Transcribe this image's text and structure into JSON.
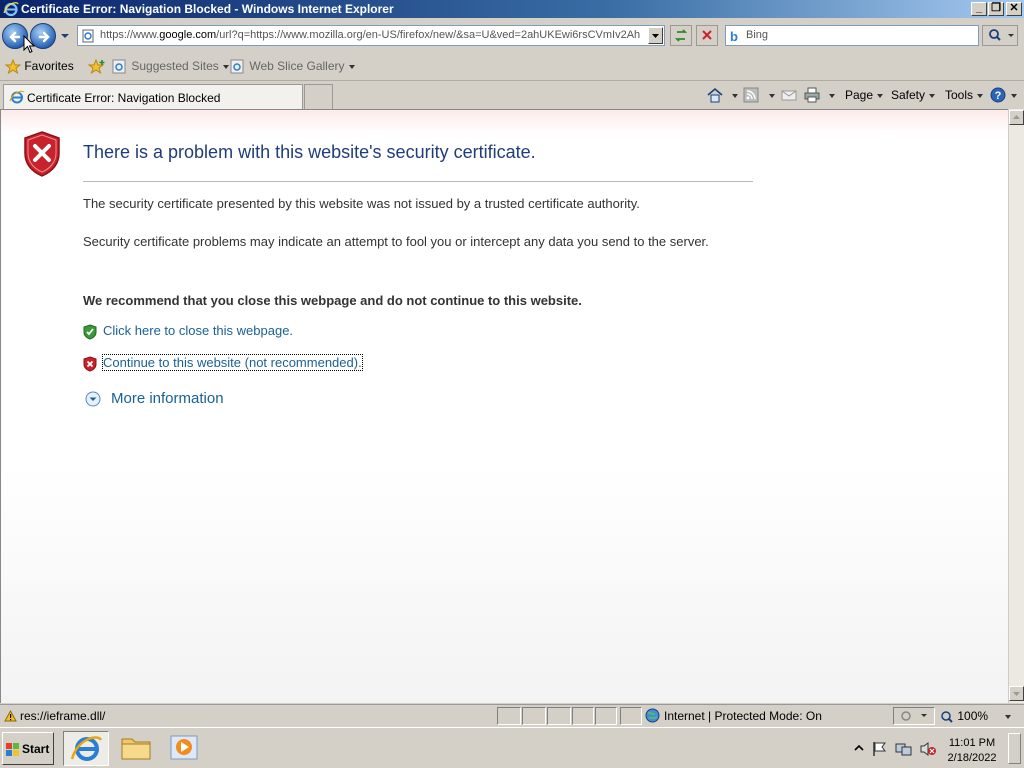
{
  "window": {
    "title": "Certificate Error: Navigation Blocked - Windows Internet Explorer",
    "controls": {
      "minimize": "_",
      "restore": "❐",
      "close": "✕"
    }
  },
  "navbar": {
    "address_url_prefix": "https://www.",
    "address_url_domain": "google.com",
    "address_url_rest": "/url?q=https://www.mozilla.org/en-US/firefox/new/&sa=U&ved=2ahUKEwi6rsCVmIv2Ah",
    "search_placeholder": "Bing"
  },
  "favorites_bar": {
    "favorites_label": "Favorites",
    "items": [
      "Suggested Sites",
      "Web Slice Gallery"
    ]
  },
  "tabs": [
    {
      "label": "Certificate Error: Navigation Blocked",
      "active": true
    }
  ],
  "command_bar": {
    "page": "Page",
    "safety": "Safety",
    "tools": "Tools"
  },
  "content": {
    "heading": "There is a problem with this website's security certificate.",
    "para1": "The security certificate presented by this website was not issued by a trusted certificate authority.",
    "para2": "Security certificate problems may indicate an attempt to fool you or intercept any data you send to the server.",
    "recommendation": "We recommend that you close this webpage and do not continue to this website.",
    "close_link": "Click here to close this webpage.",
    "continue_link": "Continue to this website (not recommended).",
    "more_info": "More information"
  },
  "statusbar": {
    "text": "res://ieframe.dll/",
    "zone": "Internet | Protected Mode: On",
    "zoom": "100%"
  },
  "taskbar": {
    "start_label": "Start",
    "time": "11:01 PM",
    "date": "2/18/2022"
  },
  "colors": {
    "link": "#1a6196",
    "heading": "#1f3d7a",
    "error_red": "#c8232c",
    "ok_green": "#3a9a3a"
  }
}
